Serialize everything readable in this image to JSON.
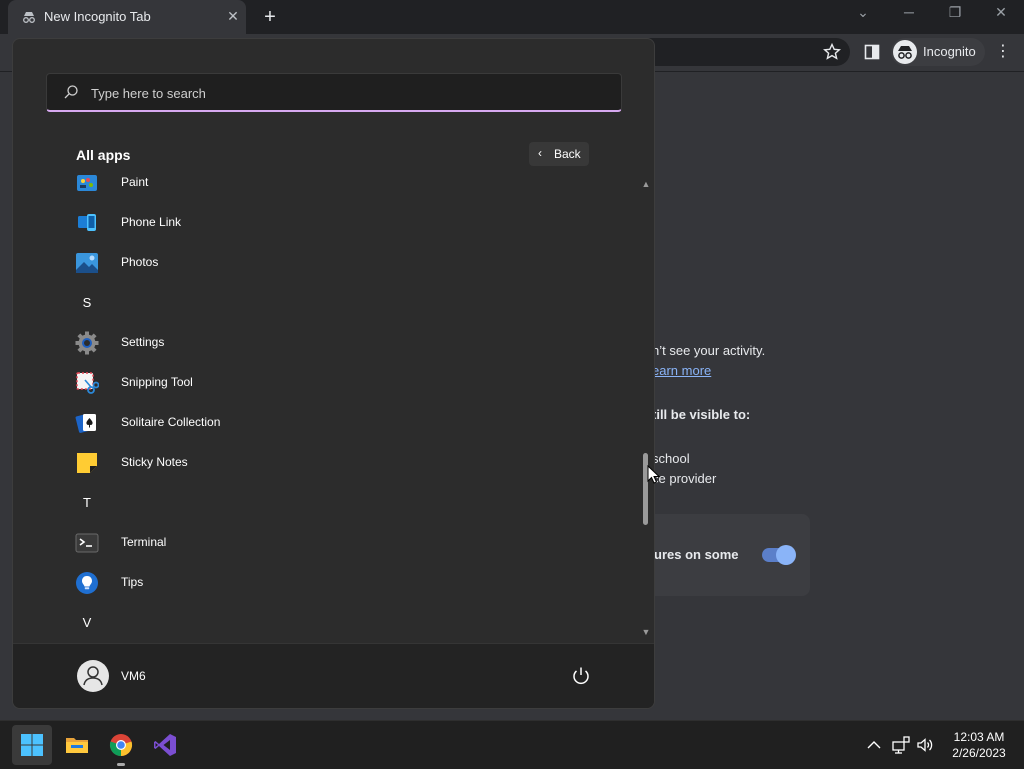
{
  "browser": {
    "tab_title": "New Incognito Tab",
    "profile_label": "Incognito",
    "page_fragments": {
      "line1": "n’t see your activity.",
      "link": "earn more",
      "line2": "till be visible to:",
      "line3": ":",
      "line4": "school",
      "line5": "ce provider",
      "cookie_text": "ures on some"
    }
  },
  "start_menu": {
    "search_placeholder": "Type here to search",
    "all_apps_label": "All apps",
    "back_label": "Back",
    "items": [
      {
        "type": "app",
        "label": "Paint",
        "icon": "paint-icon"
      },
      {
        "type": "app",
        "label": "Phone Link",
        "icon": "phone-link-icon"
      },
      {
        "type": "app",
        "label": "Photos",
        "icon": "photos-icon"
      },
      {
        "type": "letter",
        "label": "S"
      },
      {
        "type": "app",
        "label": "Settings",
        "icon": "settings-gear-icon"
      },
      {
        "type": "app",
        "label": "Snipping Tool",
        "icon": "snipping-tool-icon"
      },
      {
        "type": "app",
        "label": "Solitaire Collection",
        "icon": "solitaire-icon"
      },
      {
        "type": "app",
        "label": "Sticky Notes",
        "icon": "sticky-notes-icon"
      },
      {
        "type": "letter",
        "label": "T"
      },
      {
        "type": "app",
        "label": "Terminal",
        "icon": "terminal-icon"
      },
      {
        "type": "app",
        "label": "Tips",
        "icon": "tips-icon"
      },
      {
        "type": "letter",
        "label": "V"
      }
    ],
    "user_name": "VM6"
  },
  "taskbar": {
    "apps": [
      "start-icon",
      "file-explorer-icon",
      "chrome-icon",
      "visual-studio-icon"
    ],
    "time": "12:03 AM",
    "date": "2/26/2023"
  },
  "colors": {
    "accent_underline": "#d7a9f0",
    "link": "#8ab4f8",
    "start_bg": "#2c2c2c"
  }
}
